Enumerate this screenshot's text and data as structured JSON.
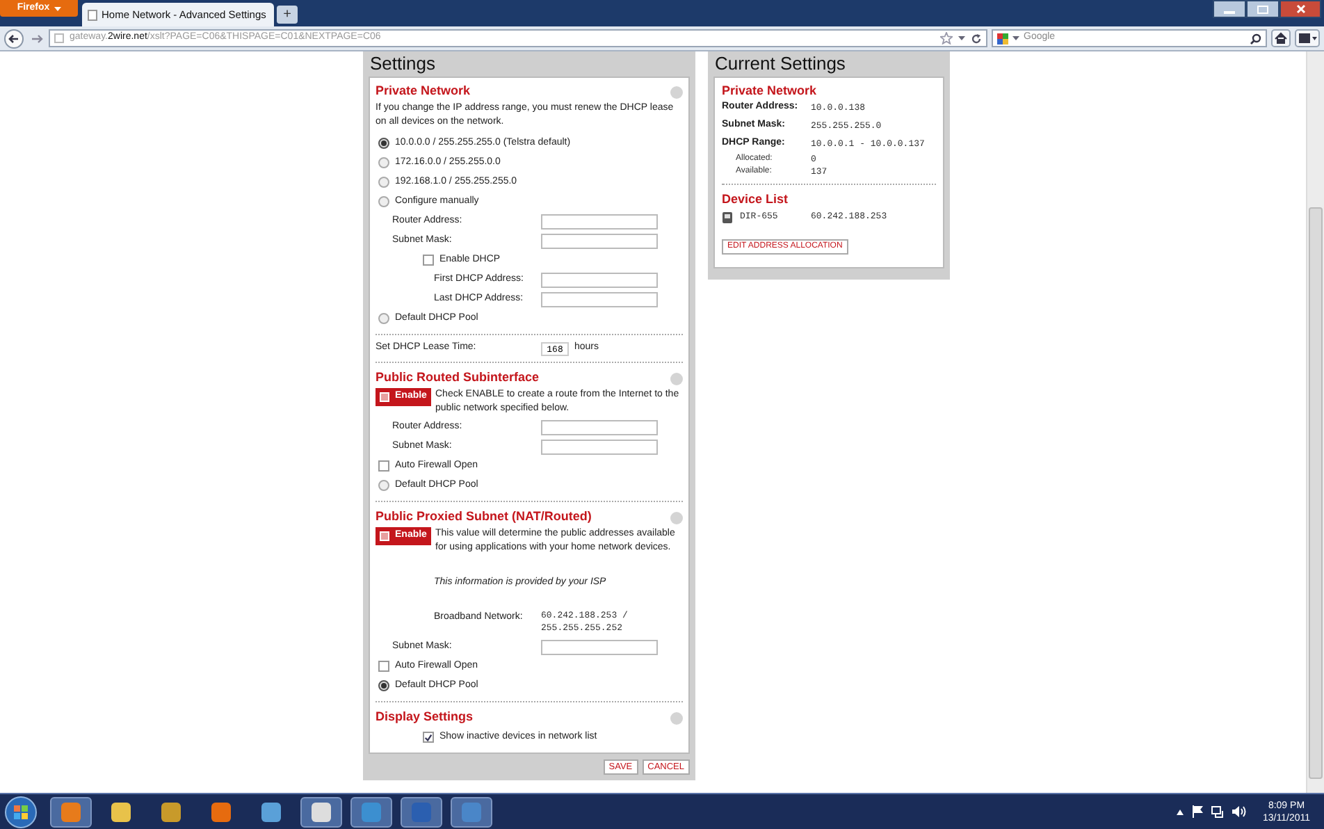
{
  "browser": {
    "menu_button": "Firefox",
    "tab_title": "Home Network - Advanced Settings",
    "new_tab": "+",
    "url_host": "gateway.",
    "url_domain": "2wire.net",
    "url_path": "/xslt?PAGE=C06&THISPAGE=C01&NEXTPAGE=C06",
    "search_placeholder": "Google"
  },
  "settings": {
    "title": "Settings",
    "private_network": {
      "title": "Private Network",
      "description": "If you change the IP address range, you must renew the DHCP lease on all devices on the network.",
      "items": [
        {
          "kind": "radio",
          "label": "10.0.0.0 / 255.255.255.0 (Telstra default)",
          "selected": true
        },
        {
          "kind": "radio",
          "label": "172.16.0.0 / 255.255.0.0",
          "selected": false
        },
        {
          "kind": "radio",
          "label": "192.168.1.0 / 255.255.255.0",
          "selected": false
        },
        {
          "kind": "radio",
          "label": "Configure manually",
          "selected": false
        },
        {
          "kind": "field",
          "label": "Router Address:"
        },
        {
          "kind": "field",
          "label": "Subnet Mask:"
        },
        {
          "kind": "subcheckbox",
          "label": "Enable DHCP",
          "checked": false
        },
        {
          "kind": "subfield",
          "label": "First DHCP Address:"
        },
        {
          "kind": "subfield",
          "label": "Last DHCP Address:"
        },
        {
          "kind": "radio",
          "label": "Default DHCP Pool",
          "selected": false
        }
      ]
    },
    "lease": {
      "label": "Set DHCP Lease Time:",
      "value": "168",
      "unit": "hours"
    },
    "public_routed": {
      "title": "Public Routed Subinterface",
      "enable": {
        "label": "Enable",
        "checked": false
      },
      "description": "Check ENABLE to create a route from the Internet to the public network specified below.",
      "items": [
        {
          "kind": "field",
          "label": "Router Address:"
        },
        {
          "kind": "field",
          "label": "Subnet Mask:"
        },
        {
          "kind": "checkbox",
          "label": "Auto Firewall Open",
          "checked": false
        },
        {
          "kind": "radio",
          "label": "Default DHCP Pool",
          "selected": false
        }
      ]
    },
    "public_proxied": {
      "title": "Public Proxied Subnet (NAT/Routed)",
      "enable": {
        "label": "Enable",
        "checked": false
      },
      "description": "This value will determine the public addresses available for using applications with your home network devices.",
      "items": [
        {
          "kind": "note",
          "label": "This information is provided by your ISP"
        },
        {
          "kind": "info",
          "label": "Broadband Network:",
          "value": "60.242.188.253 / 255.255.255.252"
        },
        {
          "kind": "field",
          "label": "Subnet Mask:"
        },
        {
          "kind": "checkbox",
          "label": "Auto Firewall Open",
          "checked": false
        },
        {
          "kind": "radio",
          "label": "Default DHCP Pool",
          "selected": true
        }
      ]
    },
    "display": {
      "title": "Display Settings",
      "items": [
        {
          "kind": "subcheckbox",
          "label": "Show inactive devices in network list",
          "checked": true
        }
      ]
    },
    "buttons": [
      "SAVE",
      "CANCEL"
    ]
  },
  "current": {
    "title": "Current Settings",
    "private_network": {
      "title": "Private Network",
      "rows": [
        {
          "kind": "main",
          "label": "Router Address:",
          "value": "10.0.0.138"
        },
        {
          "kind": "main",
          "label": "Subnet Mask:",
          "value": "255.255.255.0"
        },
        {
          "kind": "main",
          "label": "DHCP Range:",
          "value": "10.0.0.1 - 10.0.0.137"
        },
        {
          "kind": "sub",
          "label": "Allocated:",
          "value": "0"
        },
        {
          "kind": "sub",
          "label": "Available:",
          "value": "137"
        }
      ]
    },
    "device_list": {
      "title": "Device List",
      "devices": [
        {
          "name": "DIR-655",
          "address": "60.242.188.253"
        }
      ],
      "button": "EDIT ADDRESS ALLOCATION"
    }
  },
  "taskbar": {
    "time": "8:09 PM",
    "date": "13/11/2011"
  }
}
